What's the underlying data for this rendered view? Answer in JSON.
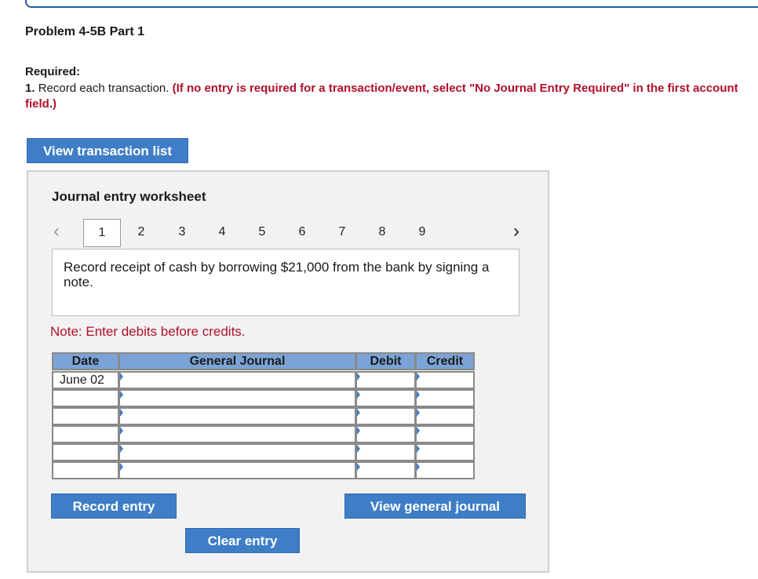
{
  "header": {
    "title": "Problem 4-5B Part 1",
    "required_label": "Required:",
    "instruction_num": "1.",
    "instruction_text": "Record each transaction.",
    "instruction_note": "(If no entry is required for a transaction/event, select \"No Journal Entry Required\" in the first account field.)"
  },
  "buttons": {
    "view_transactions": "View transaction list",
    "record_entry": "Record entry",
    "view_general_journal": "View general journal",
    "clear_entry": "Clear entry"
  },
  "worksheet": {
    "title": "Journal entry worksheet",
    "pages": [
      "1",
      "2",
      "3",
      "4",
      "5",
      "6",
      "7",
      "8",
      "9"
    ],
    "active_page": "1",
    "prev_icon": "chevron-left-icon",
    "next_icon": "chevron-right-icon",
    "description": "Record receipt of cash by borrowing $21,000 from the bank by signing a note.",
    "note": "Note: Enter debits before credits.",
    "columns": {
      "date": "Date",
      "account": "General Journal",
      "debit": "Debit",
      "credit": "Credit"
    },
    "rows": [
      {
        "date": "June 02",
        "account": "",
        "debit": "",
        "credit": ""
      },
      {
        "date": "",
        "account": "",
        "debit": "",
        "credit": ""
      },
      {
        "date": "",
        "account": "",
        "debit": "",
        "credit": ""
      },
      {
        "date": "",
        "account": "",
        "debit": "",
        "credit": ""
      },
      {
        "date": "",
        "account": "",
        "debit": "",
        "credit": ""
      },
      {
        "date": "",
        "account": "",
        "debit": "",
        "credit": ""
      }
    ]
  },
  "colors": {
    "accent": "#3f7ec7",
    "header_fill": "#7ba3d6",
    "warning": "#b0102a"
  }
}
